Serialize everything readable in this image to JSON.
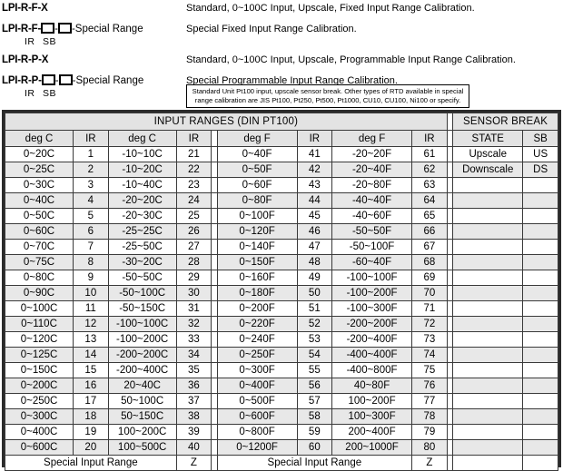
{
  "model_lines": [
    {
      "code_prefix": "LPI-R-F-X",
      "has_boxes": false,
      "suffix": "",
      "sub_left": "",
      "sub_right": "",
      "description": "Standard, 0~100C Input, Upscale, Fixed Input Range Calibration."
    },
    {
      "code_prefix": "LPI-R-F-",
      "has_boxes": true,
      "suffix": "-Special Range",
      "sub_left": "IR",
      "sub_right": "SB",
      "description": "Special Fixed Input Range Calibration."
    },
    {
      "code_prefix": "LPI-R-P-X",
      "has_boxes": false,
      "suffix": "",
      "sub_left": "",
      "sub_right": "",
      "description": "Standard, 0~100C Input, Upscale, Programmable Input Range Calibration."
    },
    {
      "code_prefix": "LPI-R-P-",
      "has_boxes": true,
      "suffix": "-Special Range",
      "sub_left": "IR",
      "sub_right": "SB",
      "description": "Special Programmable Input Range Calibration."
    }
  ],
  "note_box": {
    "line1": "Standard Unit Pt100 input, upscale sensor break. Other types of RTD available in special",
    "line2": "range calibration are JIS Pt100, Pt250, Pt500, Pt1000, CU10, CU100, Ni100 or specify."
  },
  "table": {
    "title_ranges": "INPUT RANGES (DIN PT100)",
    "title_sensor_break": "SENSOR BREAK",
    "headers": {
      "degC": "deg C",
      "ir": "IR",
      "degF": "deg F",
      "state": "STATE",
      "sb": "SB"
    },
    "special_row_label": "Special Input Range",
    "special_row_code": "Z",
    "rows": [
      {
        "c1": "0~20C",
        "ir1": "1",
        "c2": "-10~10C",
        "ir2": "21",
        "f1": "0~40F",
        "ir3": "41",
        "f2": "-20~20F",
        "ir4": "61",
        "state": "Upscale",
        "sb": "US"
      },
      {
        "c1": "0~25C",
        "ir1": "2",
        "c2": "-10~20C",
        "ir2": "22",
        "f1": "0~50F",
        "ir3": "42",
        "f2": "-20~40F",
        "ir4": "62",
        "state": "Downscale",
        "sb": "DS"
      },
      {
        "c1": "0~30C",
        "ir1": "3",
        "c2": "-10~40C",
        "ir2": "23",
        "f1": "0~60F",
        "ir3": "43",
        "f2": "-20~80F",
        "ir4": "63",
        "state": "",
        "sb": ""
      },
      {
        "c1": "0~40C",
        "ir1": "4",
        "c2": "-20~20C",
        "ir2": "24",
        "f1": "0~80F",
        "ir3": "44",
        "f2": "-40~40F",
        "ir4": "64",
        "state": "",
        "sb": ""
      },
      {
        "c1": "0~50C",
        "ir1": "5",
        "c2": "-20~30C",
        "ir2": "25",
        "f1": "0~100F",
        "ir3": "45",
        "f2": "-40~60F",
        "ir4": "65",
        "state": "",
        "sb": ""
      },
      {
        "c1": "0~60C",
        "ir1": "6",
        "c2": "-25~25C",
        "ir2": "26",
        "f1": "0~120F",
        "ir3": "46",
        "f2": "-50~50F",
        "ir4": "66",
        "state": "",
        "sb": ""
      },
      {
        "c1": "0~70C",
        "ir1": "7",
        "c2": "-25~50C",
        "ir2": "27",
        "f1": "0~140F",
        "ir3": "47",
        "f2": "-50~100F",
        "ir4": "67",
        "state": "",
        "sb": ""
      },
      {
        "c1": "0~75C",
        "ir1": "8",
        "c2": "-30~20C",
        "ir2": "28",
        "f1": "0~150F",
        "ir3": "48",
        "f2": "-60~40F",
        "ir4": "68",
        "state": "",
        "sb": ""
      },
      {
        "c1": "0~80C",
        "ir1": "9",
        "c2": "-50~50C",
        "ir2": "29",
        "f1": "0~160F",
        "ir3": "49",
        "f2": "-100~100F",
        "ir4": "69",
        "state": "",
        "sb": ""
      },
      {
        "c1": "0~90C",
        "ir1": "10",
        "c2": "-50~100C",
        "ir2": "30",
        "f1": "0~180F",
        "ir3": "50",
        "f2": "-100~200F",
        "ir4": "70",
        "state": "",
        "sb": ""
      },
      {
        "c1": "0~100C",
        "ir1": "11",
        "c2": "-50~150C",
        "ir2": "31",
        "f1": "0~200F",
        "ir3": "51",
        "f2": "-100~300F",
        "ir4": "71",
        "state": "",
        "sb": ""
      },
      {
        "c1": "0~110C",
        "ir1": "12",
        "c2": "-100~100C",
        "ir2": "32",
        "f1": "0~220F",
        "ir3": "52",
        "f2": "-200~200F",
        "ir4": "72",
        "state": "",
        "sb": ""
      },
      {
        "c1": "0~120C",
        "ir1": "13",
        "c2": "-100~200C",
        "ir2": "33",
        "f1": "0~240F",
        "ir3": "53",
        "f2": "-200~400F",
        "ir4": "73",
        "state": "",
        "sb": ""
      },
      {
        "c1": "0~125C",
        "ir1": "14",
        "c2": "-200~200C",
        "ir2": "34",
        "f1": "0~250F",
        "ir3": "54",
        "f2": "-400~400F",
        "ir4": "74",
        "state": "",
        "sb": ""
      },
      {
        "c1": "0~150C",
        "ir1": "15",
        "c2": "-200~400C",
        "ir2": "35",
        "f1": "0~300F",
        "ir3": "55",
        "f2": "-400~800F",
        "ir4": "75",
        "state": "",
        "sb": ""
      },
      {
        "c1": "0~200C",
        "ir1": "16",
        "c2": "20~40C",
        "ir2": "36",
        "f1": "0~400F",
        "ir3": "56",
        "f2": "40~80F",
        "ir4": "76",
        "state": "",
        "sb": ""
      },
      {
        "c1": "0~250C",
        "ir1": "17",
        "c2": "50~100C",
        "ir2": "37",
        "f1": "0~500F",
        "ir3": "57",
        "f2": "100~200F",
        "ir4": "77",
        "state": "",
        "sb": ""
      },
      {
        "c1": "0~300C",
        "ir1": "18",
        "c2": "50~150C",
        "ir2": "38",
        "f1": "0~600F",
        "ir3": "58",
        "f2": "100~300F",
        "ir4": "78",
        "state": "",
        "sb": ""
      },
      {
        "c1": "0~400C",
        "ir1": "19",
        "c2": "100~200C",
        "ir2": "39",
        "f1": "0~800F",
        "ir3": "59",
        "f2": "200~400F",
        "ir4": "79",
        "state": "",
        "sb": ""
      },
      {
        "c1": "0~600C",
        "ir1": "20",
        "c2": "100~500C",
        "ir2": "40",
        "f1": "0~1200F",
        "ir3": "60",
        "f2": "200~1000F",
        "ir4": "80",
        "state": "",
        "sb": ""
      }
    ]
  }
}
